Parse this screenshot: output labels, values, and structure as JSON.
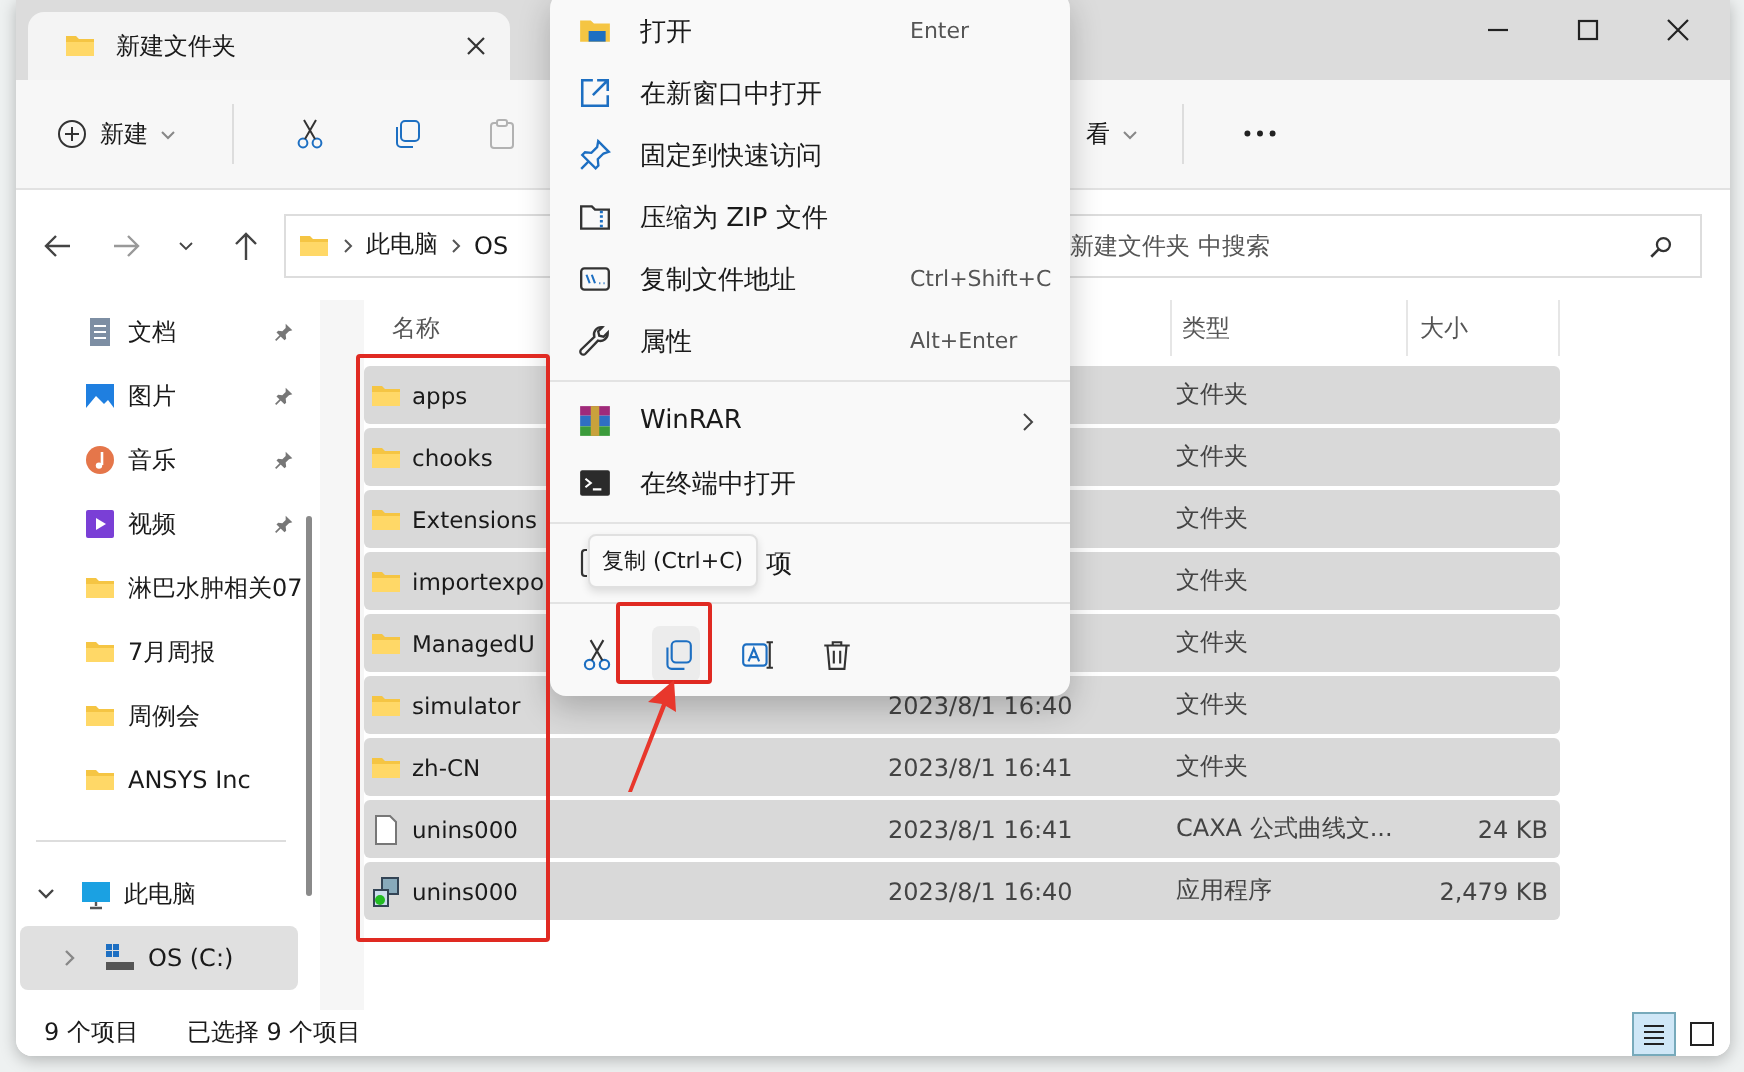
{
  "window": {
    "title": "新建文件夹"
  },
  "toolbar": [
    {
      "kind": "new",
      "label": "新建",
      "disabled": false
    },
    {
      "kind": "cut",
      "disabled": false
    },
    {
      "kind": "copy",
      "disabled": false
    },
    {
      "kind": "paste",
      "disabled": true
    },
    {
      "kind": "view",
      "label": "看",
      "disabled": false
    },
    {
      "kind": "more",
      "disabled": false
    }
  ],
  "address": {
    "breadcrumb": [
      "此电脑",
      "OS"
    ],
    "search_placeholder": "新建文件夹 中搜索"
  },
  "sidebar": {
    "items": [
      {
        "label": "文档",
        "kind": "documents",
        "pinned": true
      },
      {
        "label": "图片",
        "kind": "pictures",
        "pinned": true
      },
      {
        "label": "音乐",
        "kind": "music",
        "pinned": true
      },
      {
        "label": "视频",
        "kind": "videos",
        "pinned": true
      },
      {
        "label": "淋巴水肿相关07",
        "kind": "folder",
        "pinned": false
      },
      {
        "label": "7月周报",
        "kind": "folder",
        "pinned": false
      },
      {
        "label": "周例会",
        "kind": "folder",
        "pinned": false
      },
      {
        "label": "ANSYS Inc",
        "kind": "folder",
        "pinned": false
      }
    ],
    "this_pc": {
      "label": "此电脑",
      "expanded": true
    },
    "drive": {
      "label": "OS (C:)",
      "selected": true,
      "expanded": false
    }
  },
  "table": {
    "columns": [
      "名称",
      "类型",
      "大小"
    ],
    "rows": [
      {
        "name": "apps",
        "kind": "folder",
        "type": "文件夹",
        "selected": true
      },
      {
        "name": "chooks",
        "kind": "folder",
        "type": "文件夹",
        "selected": true
      },
      {
        "name": "Extensions",
        "kind": "folder",
        "type": "文件夹",
        "selected": true
      },
      {
        "name": "importexpo",
        "kind": "folder",
        "type": "文件夹",
        "selected": true
      },
      {
        "name": "ManagedU",
        "kind": "folder",
        "type": "文件夹",
        "selected": true
      },
      {
        "name": "simulator",
        "kind": "folder",
        "date": "2023/8/1 16:40",
        "type": "文件夹",
        "selected": true
      },
      {
        "name": "zh-CN",
        "kind": "folder",
        "date": "2023/8/1 16:41",
        "type": "文件夹",
        "selected": true
      },
      {
        "name": "unins000",
        "kind": "file",
        "date": "2023/8/1 16:41",
        "type": "CAXA 公式曲线文...",
        "size": "24 KB",
        "selected": true
      },
      {
        "name": "unins000",
        "kind": "app",
        "date": "2023/8/1 16:40",
        "type": "应用程序",
        "size": "2,479 KB",
        "selected": true
      }
    ]
  },
  "status_bar": {
    "count": "9 个项目",
    "selection": "已选择 9 个项目",
    "views": [
      {
        "kind": "details",
        "selected": true
      },
      {
        "kind": "tiles",
        "selected": false
      }
    ]
  },
  "context_menu": {
    "groups": [
      [
        {
          "kind": "open",
          "label": "打开",
          "shortcut": "Enter"
        },
        {
          "kind": "new-window",
          "label": "在新窗口中打开"
        },
        {
          "kind": "pin",
          "label": "固定到快速访问"
        },
        {
          "kind": "zip",
          "label": "压缩为 ZIP 文件"
        },
        {
          "kind": "path",
          "label": "复制文件地址",
          "shortcut": "Ctrl+Shift+C"
        },
        {
          "kind": "properties",
          "label": "属性",
          "shortcut": "Alt+Enter"
        }
      ],
      [
        {
          "kind": "winrar",
          "label": "WinRAR",
          "submenu": true
        },
        {
          "kind": "terminal",
          "label": "在终端中打开"
        }
      ],
      [
        {
          "kind": "more",
          "label": "项"
        }
      ]
    ],
    "actions": [
      {
        "kind": "cut",
        "highlighted": false
      },
      {
        "kind": "copy",
        "highlighted": true
      },
      {
        "kind": "rename",
        "highlighted": false
      },
      {
        "kind": "delete",
        "highlighted": false
      }
    ],
    "tooltip": "复制 (Ctrl+C)"
  }
}
